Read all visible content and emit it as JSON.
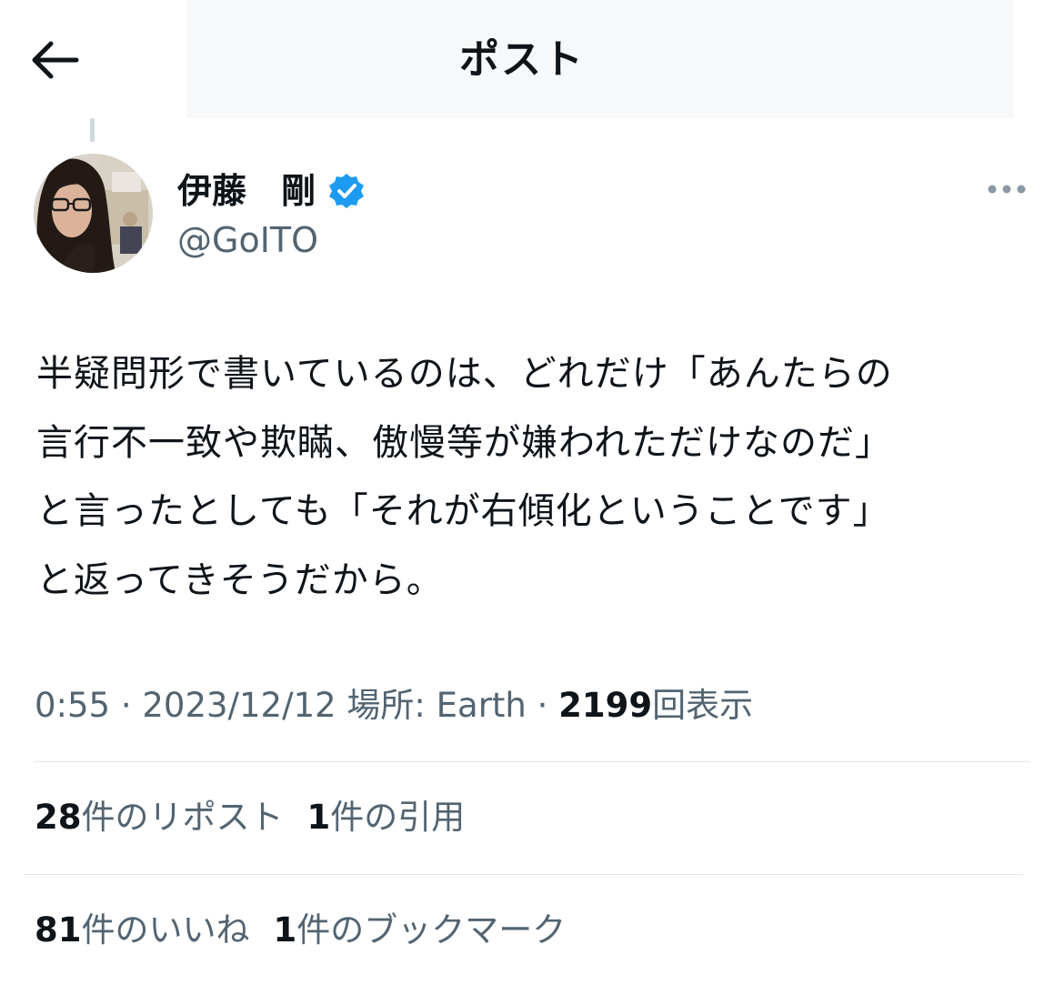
{
  "header": {
    "title": "ポスト"
  },
  "author": {
    "display_name": "伊藤　剛",
    "handle": "@GoITO",
    "verified": true,
    "verified_color": "#1d9bf0"
  },
  "tweet": {
    "lines": [
      "半疑問形で書いているのは、どれだけ「あんたらの",
      "言行不一致や欺瞞、傲慢等が嫌われただけなのだ」",
      "と言ったとしても「それが右傾化ということです」",
      "と返ってきそうだから。"
    ]
  },
  "meta": {
    "time": "0:55",
    "separator": "·",
    "date": "2023/12/12",
    "location": "場所: Earth",
    "views_count": "2199",
    "views_label": "回表示"
  },
  "stats": {
    "reposts_count": "28",
    "reposts_label": "件のリポスト",
    "quotes_count": "1",
    "quotes_label": "件の引用",
    "likes_count": "81",
    "likes_label": "件のいいね",
    "bookmarks_count": "1",
    "bookmarks_label": "件のブックマーク"
  },
  "icons": {
    "back": "arrow-left-icon",
    "more": "ellipsis-icon",
    "verified": "verified-badge-icon"
  }
}
